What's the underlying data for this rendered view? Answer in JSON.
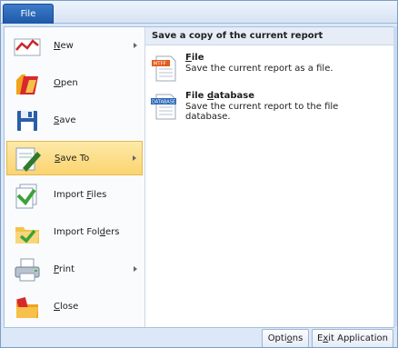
{
  "file_tab": "File",
  "menu": {
    "items": [
      {
        "pre": "",
        "key": "N",
        "post": "ew",
        "icon": "new-chart-icon",
        "arrow": true
      },
      {
        "pre": "",
        "key": "O",
        "post": "pen",
        "icon": "open-folder-icon",
        "arrow": false
      },
      {
        "pre": "",
        "key": "S",
        "post": "ave",
        "icon": "save-disk-icon",
        "arrow": false
      },
      {
        "pre": "",
        "key": "S",
        "post": "ave To",
        "icon": "save-to-icon",
        "arrow": true
      },
      {
        "pre": "Import ",
        "key": "F",
        "post": "iles",
        "icon": "import-files-icon",
        "arrow": false
      },
      {
        "pre": "Import Fol",
        "key": "d",
        "post": "ers",
        "icon": "import-folders-icon",
        "arrow": false
      },
      {
        "pre": "",
        "key": "P",
        "post": "rint",
        "icon": "printer-icon",
        "arrow": true
      },
      {
        "pre": "",
        "key": "C",
        "post": "lose",
        "icon": "close-folder-icon",
        "arrow": false
      }
    ]
  },
  "submenu": {
    "header": "Save a copy of the current report",
    "items": [
      {
        "title": "File",
        "title_key": "F",
        "title_rest": "ile",
        "desc": "Save the current report as a file.",
        "icon": "mtff-file-icon",
        "icon_text": "MTFF"
      },
      {
        "title_pre": "File ",
        "title_key": "d",
        "title_rest": "atabase",
        "desc": "Save the current report to the file database.",
        "icon": "database-file-icon",
        "icon_text": "DATABASE"
      }
    ]
  },
  "buttons": {
    "options_pre": "Opti",
    "options_key": "o",
    "options_post": "ns",
    "exit_pre": "E",
    "exit_key": "x",
    "exit_post": "it Application"
  },
  "colors": {
    "accent": "#2a67b6",
    "highlight": "#fbd46f"
  }
}
